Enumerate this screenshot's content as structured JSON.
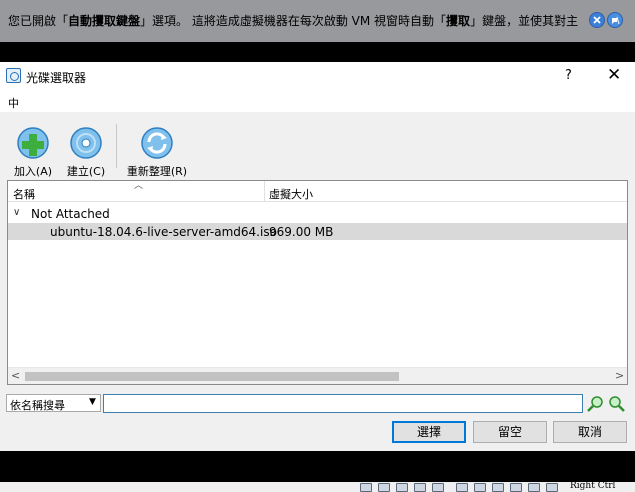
{
  "banner": {
    "text_before": "您已開啟「",
    "text_bold1": "自動攫取鍵盤",
    "text_mid": "」選項。 這將造成虛擬機器在每次啟動 VM 視窗時自動「",
    "text_bold2": "攫取",
    "text_after": "」鍵盤，並使其對主",
    "close_icon": "close-icon",
    "mute_icon": "mute-icon",
    "accent": "#3d7fd6"
  },
  "dialog": {
    "title": "光碟選取器",
    "help": "?",
    "close": "✕"
  },
  "menu": {
    "item": "中"
  },
  "toolbar": {
    "add_label": "加入(A)",
    "create_label": "建立(C)",
    "refresh_label": "重新整理(R)"
  },
  "tree": {
    "columns": [
      "名稱",
      "虛擬大小"
    ],
    "groups": [
      {
        "label": "Not Attached",
        "items": [
          {
            "name": "ubuntu-18.04.6-live-server-amd64.iso",
            "size": "969.00 MB"
          }
        ]
      }
    ]
  },
  "search": {
    "mode": "依名稱搜尋",
    "value": ""
  },
  "actions": {
    "choose": "選擇",
    "leave_empty": "留空",
    "cancel": "取消"
  },
  "statusbar": {
    "host_key": "Right Ctrl"
  }
}
